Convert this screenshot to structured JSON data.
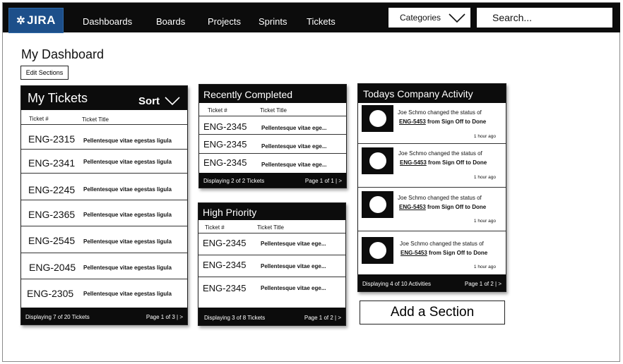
{
  "header": {
    "logo_text": "JIRA",
    "nav": [
      "Dashboards",
      "Boards",
      "Projects",
      "Sprints",
      "Tickets"
    ],
    "categories_label": "Categories",
    "search_placeholder": "Search..."
  },
  "page": {
    "title": "My Dashboard",
    "edit_sections_label": "Edit Sections",
    "add_section_label": "Add a Section"
  },
  "my_tickets": {
    "title": "My Tickets",
    "sort_label": "Sort",
    "col_id": "Ticket #",
    "col_title": "Ticket Title",
    "rows": [
      {
        "id": "ENG-2315",
        "title": "Pellentesque vitae egestas ligula"
      },
      {
        "id": "ENG-2341",
        "title": "Pellentesque vitae egestas ligula"
      },
      {
        "id": "ENG-2245",
        "title": "Pellentesque vitae egestas ligula"
      },
      {
        "id": "ENG-2365",
        "title": "Pellentesque vitae egestas ligula"
      },
      {
        "id": "ENG-2545",
        "title": "Pellentesque vitae egestas ligula"
      },
      {
        "id": "ENG-2045",
        "title": "Pellentesque vitae egestas ligula"
      },
      {
        "id": "ENG-2305",
        "title": "Pellentesque vitae egestas ligula"
      }
    ],
    "footer_left": "Displaying 7 of 20 Tickets",
    "footer_right": "Page 1 of 3 | >"
  },
  "recently_completed": {
    "title": "Recently Completed",
    "col_id": "Ticket #",
    "col_title": "Ticket Title",
    "rows": [
      {
        "id": "ENG-2345",
        "title": "Pellentesque vitae ege..."
      },
      {
        "id": "ENG-2345",
        "title": "Pellentesque vitae ege..."
      },
      {
        "id": "ENG-2345",
        "title": "Pellentesque vitae ege..."
      }
    ],
    "footer_left": "Displaying 2 of 2 Tickets",
    "footer_right": "Page 1 of 1 | >"
  },
  "high_priority": {
    "title": "High Priority",
    "col_id": "Ticket #",
    "col_title": "Ticket Title",
    "rows": [
      {
        "id": "ENG-2345",
        "title": "Pellentesque vitae ege..."
      },
      {
        "id": "ENG-2345",
        "title": "Pellentesque vitae ege..."
      },
      {
        "id": "ENG-2345",
        "title": "Pellentesque vitae ege..."
      }
    ],
    "footer_left": "Displaying 3 of 8 Tickets",
    "footer_right": "Page 1 of 2 | >"
  },
  "activity": {
    "title": "Todays Company Activity",
    "items": [
      {
        "user": "Joe Schmo",
        "action": "changed the status of",
        "ticket": "ENG-5453",
        "from_label": "from",
        "from": "Sign Off",
        "to_label": "to",
        "to": "Done",
        "time": "1 hour ago"
      },
      {
        "user": "Joe Schmo",
        "action": "changed the status of",
        "ticket": "ENG-5453",
        "from_label": "from",
        "from": "Sign Off",
        "to_label": "to",
        "to": "Done",
        "time": "1 hour ago"
      },
      {
        "user": "Joe Schmo",
        "action": "changed the status of",
        "ticket": "ENG-5453",
        "from_label": "from",
        "from": "Sign Off",
        "to_label": "to",
        "to": "Done",
        "time": "1 hour ago"
      },
      {
        "user": "Joe Schmo",
        "action": "changed the status of",
        "ticket": "ENG-5453",
        "from_label": "from",
        "from": "Sign Off",
        "to_label": "to",
        "to": "Done",
        "time": "1 hour ago"
      }
    ],
    "footer_left": "Displaying 4 of 10 Activities",
    "footer_right": "Page 1 of 2 | >"
  }
}
